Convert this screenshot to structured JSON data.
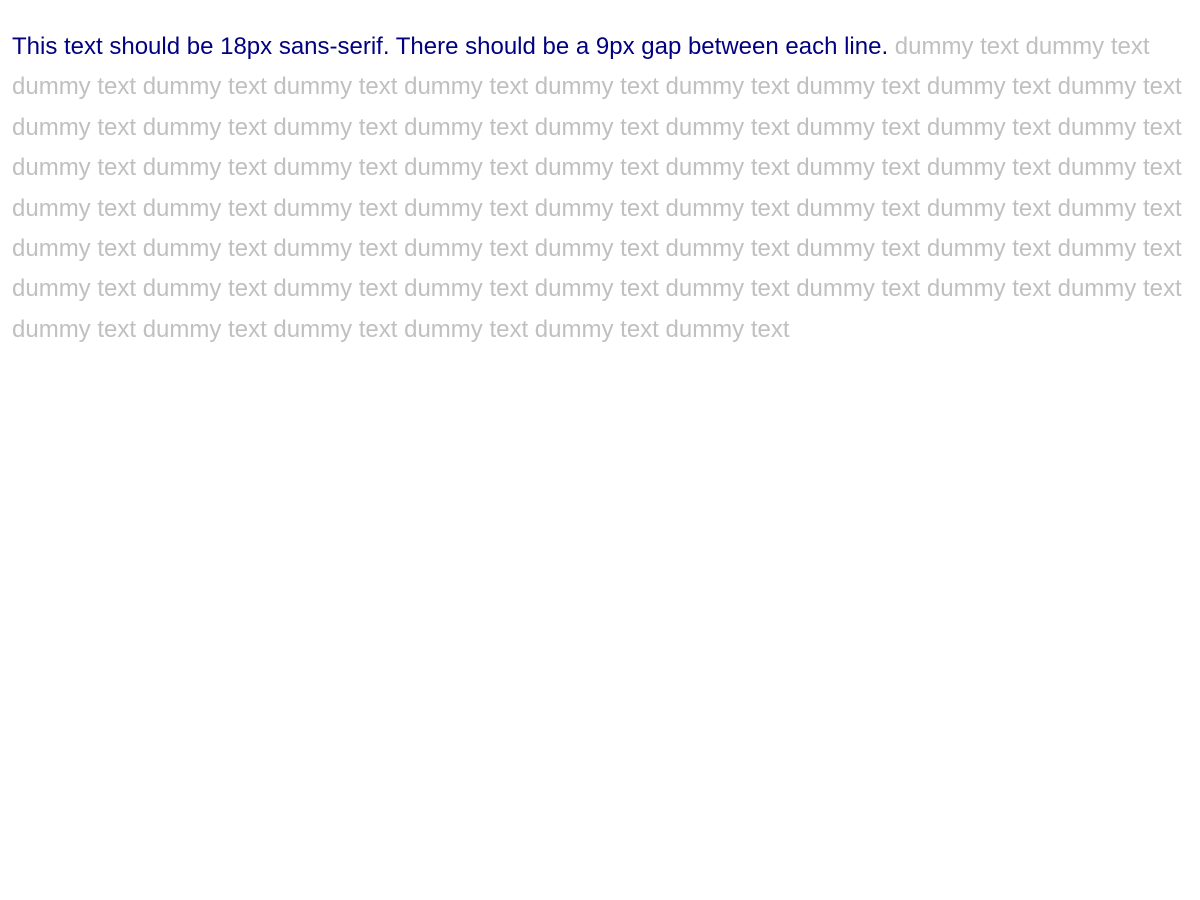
{
  "instruction": {
    "text": "This text should be 18px sans-serif. There should be a 9px gap between each line.",
    "color": "#000080"
  },
  "filler": {
    "text": "dummy text dummy text dummy text dummy text dummy text dummy text dummy text dummy text dummy text dummy text dummy text dummy text dummy text dummy text dummy text dummy text dummy text dummy text dummy text dummy text dummy text dummy text dummy text dummy text dummy text dummy text dummy text dummy text dummy text dummy text dummy text dummy text dummy text dummy text dummy text dummy text dummy text dummy text dummy text dummy text dummy text dummy text dummy text dummy text dummy text dummy text dummy text dummy text dummy text dummy text dummy text dummy text dummy text dummy text dummy text dummy text dummy text dummy text dummy text dummy text dummy text dummy text",
    "color": "#c0c0c0"
  }
}
